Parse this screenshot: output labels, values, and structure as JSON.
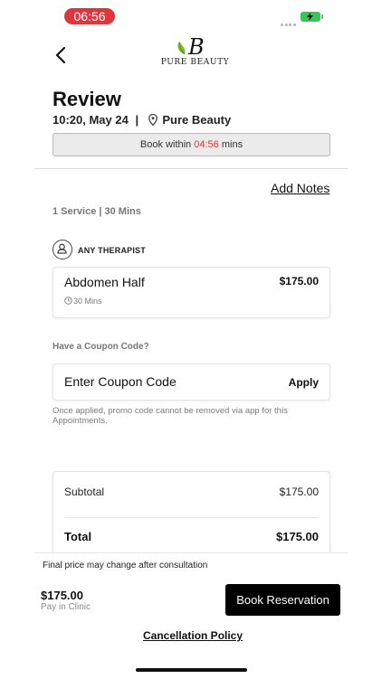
{
  "status_bar": {
    "time": "06:56"
  },
  "header": {
    "brand": "PURE BEAUTY",
    "logo_letter": "B"
  },
  "review": {
    "title": "Review",
    "datetime": "10:20, May 24",
    "separator": "|",
    "location": "Pure Beauty",
    "timer_prefix": "Book within",
    "timer_value": "04:56",
    "timer_suffix": "mins"
  },
  "notes": {
    "add_label": "Add Notes"
  },
  "service_summary": "1 Service | 30 Mins",
  "therapist": {
    "label": "ANY THERAPIST",
    "icon": "person-icon"
  },
  "service": {
    "name": "Abdomen Half",
    "price": "$175.00",
    "duration": "30 Mins"
  },
  "coupon": {
    "question": "Have a Coupon Code?",
    "placeholder": "Enter Coupon Code",
    "apply_label": "Apply",
    "note": "Once applied, promo code cannot be removed via app for this Appointments."
  },
  "summary": {
    "subtotal_label": "Subtotal",
    "subtotal_value": "$175.00",
    "total_label": "Total",
    "total_value": "$175.00"
  },
  "footer": {
    "note": "Final price may change after consultation",
    "amount": "$175.00",
    "payment_method": "Pay in Clinic",
    "book_label": "Book Reservation",
    "cancellation_label": "Cancellation Policy"
  },
  "colors": {
    "accent_red": "#e0353a",
    "battery_green": "#34c759",
    "button_black": "#000000"
  }
}
